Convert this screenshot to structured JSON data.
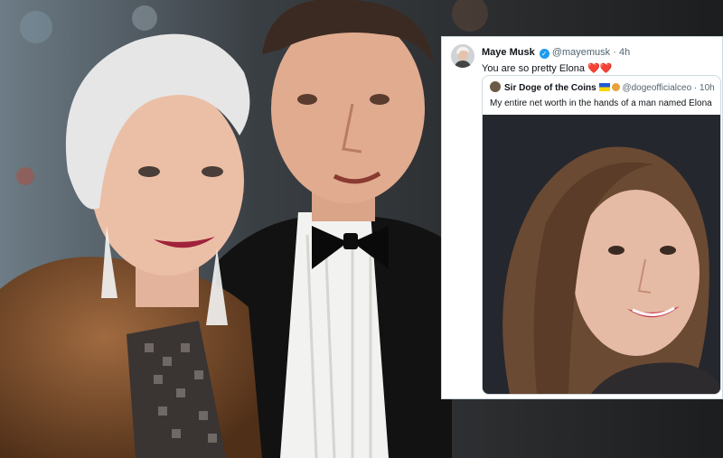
{
  "tweet": {
    "display_name": "Maye Musk",
    "verified": true,
    "handle": "@mayemusk",
    "separator": "·",
    "time": "4h",
    "text": "You are so pretty Elona ❤️❤️",
    "quote": {
      "display_name": "Sir Doge of the Coins",
      "handle": "@dogeofficialceo",
      "separator": "·",
      "time": "10h",
      "text": "My entire net worth in the hands of a man named Elona"
    }
  },
  "colors": {
    "link_blue": "#1d9bf0",
    "text_primary": "#0f1419",
    "text_secondary": "#536471",
    "heart_red": "#e0245e"
  },
  "icons": {
    "verified": "verified-badge-icon",
    "flag": "ukraine-flag-icon",
    "emoji": "doge-emoji-icon"
  }
}
